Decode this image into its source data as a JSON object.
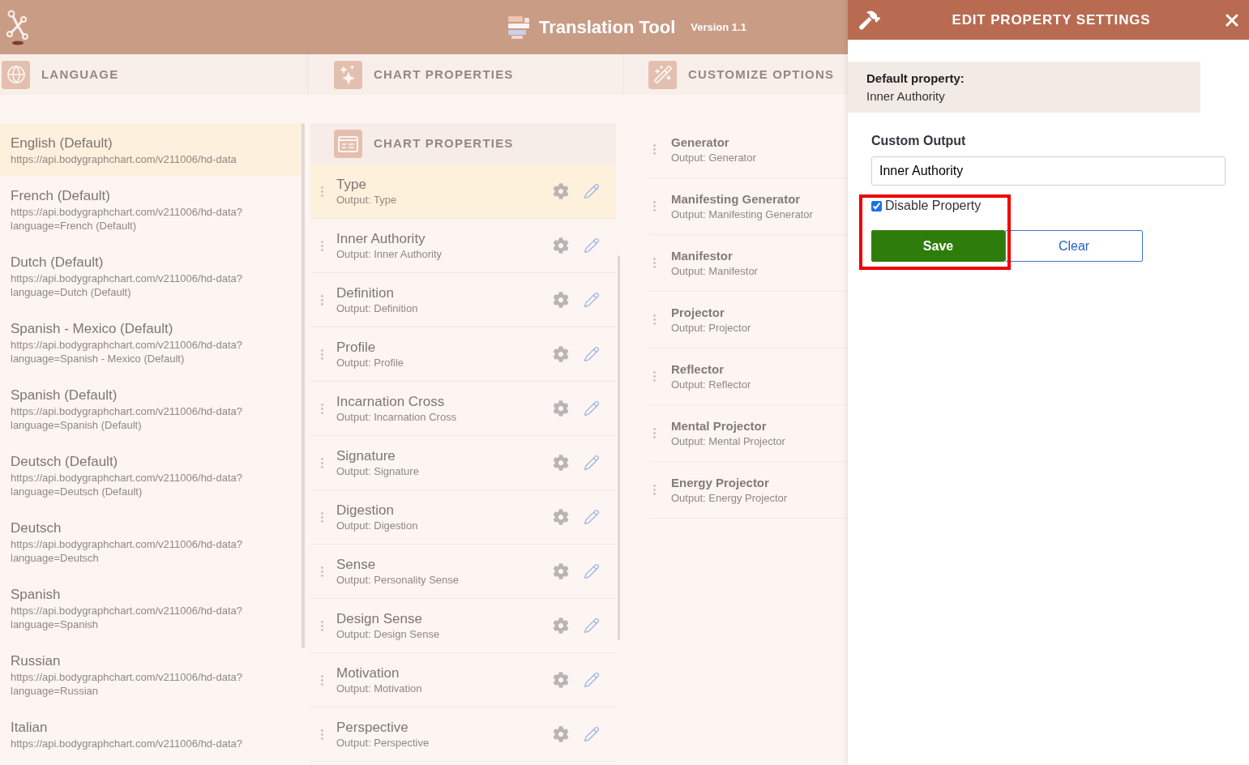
{
  "header": {
    "title": "Translation Tool",
    "version": "Version 1.1"
  },
  "sections": [
    {
      "label": "LANGUAGE"
    },
    {
      "label": "CHART PROPERTIES"
    },
    {
      "label": "CUSTOMIZE OPTIONS"
    }
  ],
  "languages": [
    {
      "name": "English (Default)",
      "url": "https://api.bodygraphchart.com/v211006/hd-data",
      "selected": true
    },
    {
      "name": "French (Default)",
      "url": "https://api.bodygraphchart.com/v211006/hd-data?language=French (Default)",
      "selected": false
    },
    {
      "name": "Dutch (Default)",
      "url": "https://api.bodygraphchart.com/v211006/hd-data?language=Dutch (Default)",
      "selected": false
    },
    {
      "name": "Spanish - Mexico (Default)",
      "url": "https://api.bodygraphchart.com/v211006/hd-data?language=Spanish - Mexico (Default)",
      "selected": false
    },
    {
      "name": "Spanish (Default)",
      "url": "https://api.bodygraphchart.com/v211006/hd-data?language=Spanish (Default)",
      "selected": false
    },
    {
      "name": "Deutsch (Default)",
      "url": "https://api.bodygraphchart.com/v211006/hd-data?language=Deutsch (Default)",
      "selected": false
    },
    {
      "name": "Deutsch",
      "url": "https://api.bodygraphchart.com/v211006/hd-data?language=Deutsch",
      "selected": false
    },
    {
      "name": "Spanish",
      "url": "https://api.bodygraphchart.com/v211006/hd-data?language=Spanish",
      "selected": false
    },
    {
      "name": "Russian",
      "url": "https://api.bodygraphchart.com/v211006/hd-data?language=Russian",
      "selected": false
    },
    {
      "name": "Italian",
      "url": "https://api.bodygraphchart.com/v211006/hd-data?",
      "selected": false
    }
  ],
  "chart_properties": {
    "title": "CHART PROPERTIES",
    "items": [
      {
        "name": "Type",
        "output": "Output: Type",
        "selected": true
      },
      {
        "name": "Inner Authority",
        "output": "Output: Inner Authority",
        "selected": false
      },
      {
        "name": "Definition",
        "output": "Output: Definition",
        "selected": false
      },
      {
        "name": "Profile",
        "output": "Output: Profile",
        "selected": false
      },
      {
        "name": "Incarnation Cross",
        "output": "Output: Incarnation Cross",
        "selected": false
      },
      {
        "name": "Signature",
        "output": "Output: Signature",
        "selected": false
      },
      {
        "name": "Digestion",
        "output": "Output: Digestion",
        "selected": false
      },
      {
        "name": "Sense",
        "output": "Output: Personality Sense",
        "selected": false
      },
      {
        "name": "Design Sense",
        "output": "Output: Design Sense",
        "selected": false
      },
      {
        "name": "Motivation",
        "output": "Output: Motivation",
        "selected": false
      },
      {
        "name": "Perspective",
        "output": "Output: Perspective",
        "selected": false
      }
    ]
  },
  "customize_options": [
    {
      "name": "Generator",
      "output": "Output: Generator"
    },
    {
      "name": "Manifesting Generator",
      "output": "Output: Manifesting Generator"
    },
    {
      "name": "Manifestor",
      "output": "Output: Manifestor"
    },
    {
      "name": "Projector",
      "output": "Output: Projector"
    },
    {
      "name": "Reflector",
      "output": "Output: Reflector"
    },
    {
      "name": "Mental Projector",
      "output": "Output: Mental Projector"
    },
    {
      "name": "Energy Projector",
      "output": "Output: Energy Projector"
    }
  ],
  "drawer": {
    "title": "EDIT PROPERTY SETTINGS",
    "default_label": "Default property:",
    "default_value": "Inner Authority",
    "field_label": "Custom Output",
    "field_value": "Inner Authority",
    "checkbox": {
      "label": "Disable Property",
      "checked": true
    },
    "buttons": [
      {
        "label": "Save",
        "kind": "primary"
      },
      {
        "label": "Clear",
        "kind": "outline"
      }
    ]
  }
}
